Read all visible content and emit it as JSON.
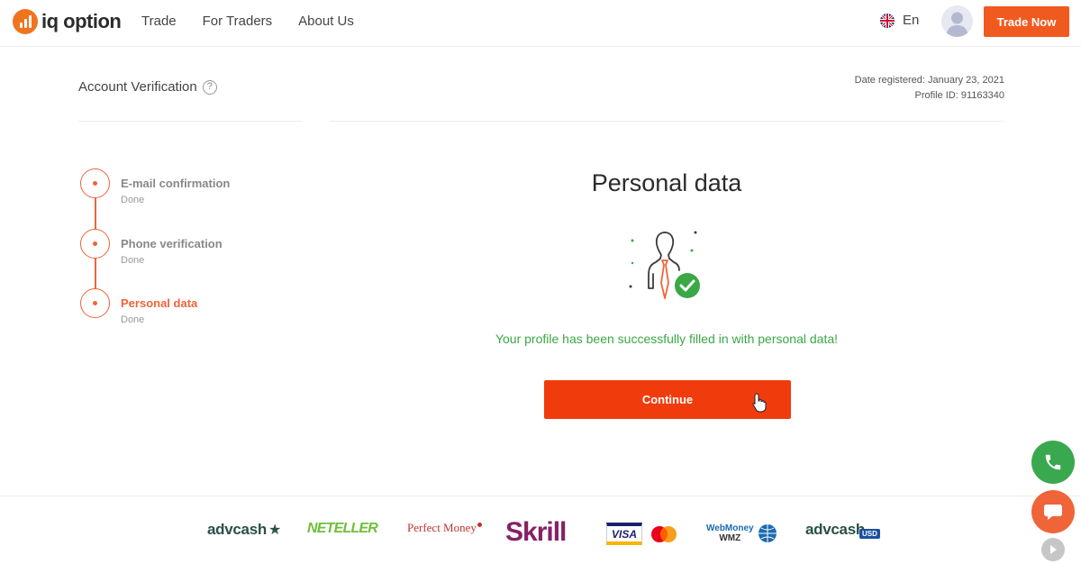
{
  "header": {
    "logo_text": "iq option",
    "nav": [
      {
        "label": "Trade"
      },
      {
        "label": "For Traders"
      },
      {
        "label": "About Us"
      }
    ],
    "language": "En",
    "cta": "Trade Now"
  },
  "page": {
    "title": "Account Verification",
    "help_glyph": "?",
    "date_registered": "Date registered: January 23, 2021",
    "profile_id": "Profile ID: 91163340"
  },
  "steps": [
    {
      "title": "E-mail confirmation",
      "status": "Done",
      "active": false
    },
    {
      "title": "Phone verification",
      "status": "Done",
      "active": false
    },
    {
      "title": "Personal data",
      "status": "Done",
      "active": true
    }
  ],
  "main": {
    "title": "Personal data",
    "success_message": "Your profile has been successfully filled in with personal data!",
    "continue_label": "Continue"
  },
  "payments": {
    "advcash": "advcash",
    "neteller": "NETELLER",
    "perfect_money": "Perfect Money",
    "skrill": "Skrill",
    "visa": "VISA",
    "webmoney_top": "WebMoney",
    "webmoney_bottom": "WMZ",
    "advcash_usd": "advcash",
    "usd_badge": "USD"
  },
  "colors": {
    "accent": "#f05a1e",
    "success": "#3aa845",
    "chat": "#f0643a"
  },
  "icons": [
    "logo-icon",
    "uk-flag-icon",
    "avatar-icon",
    "help-icon",
    "profile-check-icon",
    "pointer-cursor-icon",
    "phone-icon",
    "chat-icon",
    "play-icon"
  ]
}
